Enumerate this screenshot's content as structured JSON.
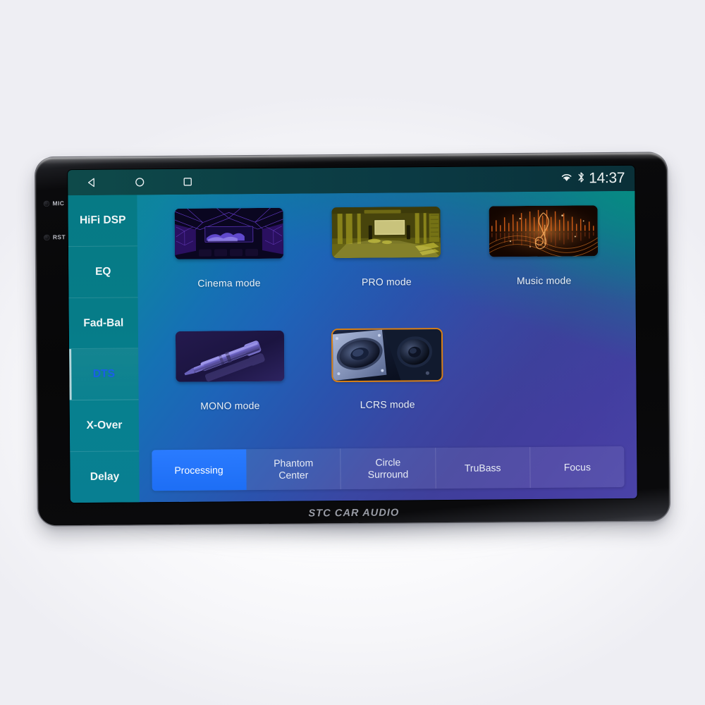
{
  "device": {
    "brand_text": "STC CAR AUDIO",
    "bezel_buttons": [
      {
        "label": "MIC",
        "icon": "mic-hole-icon"
      },
      {
        "label": "RST",
        "icon": "reset-hole-icon"
      }
    ]
  },
  "status_bar": {
    "nav": [
      {
        "name": "back",
        "icon": "back-triangle-icon"
      },
      {
        "name": "home",
        "icon": "home-circle-icon"
      },
      {
        "name": "recents",
        "icon": "recents-square-icon"
      }
    ],
    "wifi_icon": "wifi-icon",
    "bluetooth_icon": "bluetooth-icon",
    "clock": "14:37"
  },
  "sidebar": {
    "items": [
      {
        "label": "HiFi DSP",
        "active": false
      },
      {
        "label": "EQ",
        "active": false
      },
      {
        "label": "Fad-Bal",
        "active": false
      },
      {
        "label": "DTS",
        "active": true
      },
      {
        "label": "X-Over",
        "active": false
      },
      {
        "label": "Delay",
        "active": false
      }
    ],
    "active_color": "#1a5fe6"
  },
  "main": {
    "modes": [
      {
        "label": "Cinema mode",
        "art": "cinema-theater-thumb",
        "selected": false
      },
      {
        "label": "PRO mode",
        "art": "pro-studio-thumb",
        "selected": false
      },
      {
        "label": "Music mode",
        "art": "music-waveform-thumb",
        "selected": false
      },
      {
        "label": "MONO mode",
        "art": "mono-jack-plug-thumb",
        "selected": false
      },
      {
        "label": "LCRS mode",
        "art": "lcrs-speakers-thumb",
        "selected": true
      }
    ],
    "selected_border_color": "#d98014"
  },
  "tabs": {
    "items": [
      {
        "label": "Processing",
        "active": true
      },
      {
        "label": "Phantom\nCenter",
        "active": false
      },
      {
        "label": "Circle\nSurround",
        "active": false
      },
      {
        "label": "TruBass",
        "active": false
      },
      {
        "label": "Focus",
        "active": false
      }
    ],
    "active_color": "#1d6ef5"
  }
}
